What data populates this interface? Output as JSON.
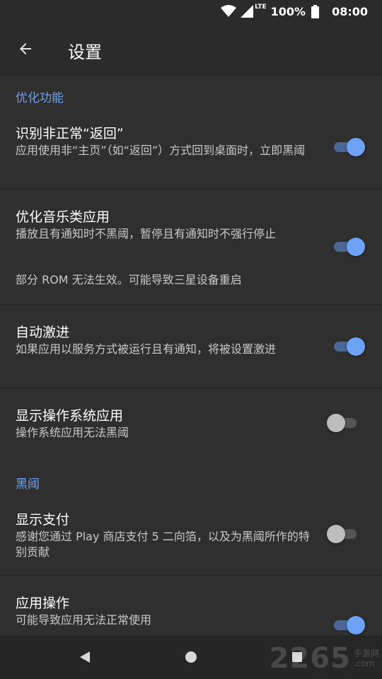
{
  "status_bar": {
    "network": "LTE",
    "battery": "100%",
    "time": "08:00"
  },
  "app_bar": {
    "title": "设置"
  },
  "sections": [
    {
      "header": "优化功能",
      "items": [
        {
          "title": "识别非正常“返回”",
          "subtitle": "应用使用非“主页”（如“返回”）方式回到桌面时，立即黑阈",
          "switch_on": true
        },
        {
          "title": "优化音乐类应用",
          "subtitle": "播放且有通知时不黑阈，暂停且有通知时不强行停止",
          "note": "部分 ROM 无法生效。可能导致三星设备重启",
          "switch_on": true
        },
        {
          "title": "自动激进",
          "subtitle": "如果应用以服务方式被运行且有通知，将被设置激进",
          "switch_on": true
        },
        {
          "title": "显示操作系统应用",
          "subtitle": "操作系统应用无法黑阈",
          "switch_on": false
        }
      ]
    },
    {
      "header": "黑阈",
      "items": [
        {
          "title": "显示支付",
          "subtitle": "感谢您通过 Play 商店支付 5 二向箔，以及为黑阈所作的特别贡献",
          "switch_on": false
        },
        {
          "title": "应用操作",
          "subtitle": "可能导致应用无法正常使用",
          "switch_on": true
        }
      ]
    }
  ],
  "watermark": {
    "big": "2265",
    "small_top": "手游网",
    "small_bottom": ".com"
  },
  "colors": {
    "background": "#2f2f2f",
    "accent": "#6fa0ef",
    "switch_on_thumb": "#6ea2f5",
    "switch_off_thumb": "#bdbdbd"
  }
}
